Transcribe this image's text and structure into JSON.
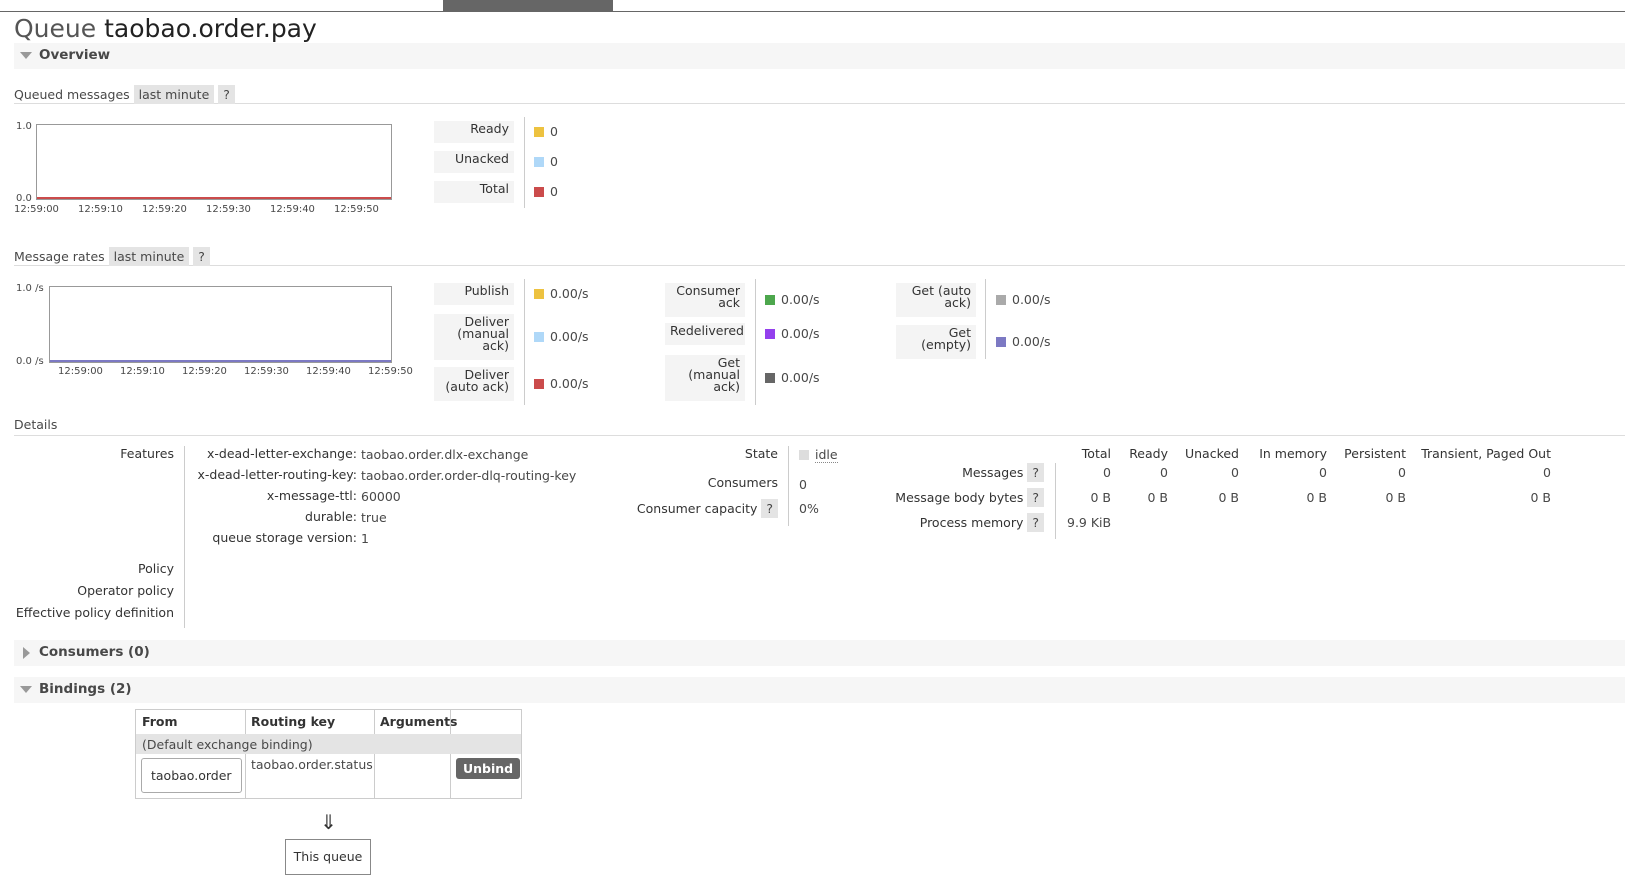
{
  "page": {
    "title_prefix": "Queue",
    "queue_name": "taobao.order.pay"
  },
  "sections": {
    "overview": "Overview",
    "consumers": "Consumers (0)",
    "bindings": "Bindings (2)"
  },
  "queued": {
    "heading": "Queued messages",
    "range": "last minute",
    "help": "?",
    "y_top": "1.0",
    "y_bottom": "0.0",
    "x_ticks": [
      "12:59:00",
      "12:59:10",
      "12:59:20",
      "12:59:30",
      "12:59:40",
      "12:59:50"
    ],
    "legend": [
      {
        "label": "Ready",
        "value": "0",
        "color": "#edc240"
      },
      {
        "label": "Unacked",
        "value": "0",
        "color": "#afd8f8"
      },
      {
        "label": "Total",
        "value": "0",
        "color": "#cb4b4b"
      }
    ]
  },
  "rates": {
    "heading": "Message rates",
    "range": "last minute",
    "help": "?",
    "y_top": "1.0 /s",
    "y_bottom": "0.0 /s",
    "x_ticks": [
      "12:59:00",
      "12:59:10",
      "12:59:20",
      "12:59:30",
      "12:59:40",
      "12:59:50"
    ],
    "col1": [
      {
        "label": "Publish",
        "value": "0.00/s",
        "color": "#edc240"
      },
      {
        "label": "Deliver (manual ack)",
        "value": "0.00/s",
        "color": "#afd8f8"
      },
      {
        "label": "Deliver (auto ack)",
        "value": "0.00/s",
        "color": "#cb4b4b"
      }
    ],
    "col2": [
      {
        "label": "Consumer ack",
        "value": "0.00/s",
        "color": "#4da74d"
      },
      {
        "label": "Redelivered",
        "value": "0.00/s",
        "color": "#9440ed"
      },
      {
        "label": "Get (manual ack)",
        "value": "0.00/s",
        "color": "#666666"
      }
    ],
    "col3": [
      {
        "label": "Get (auto ack)",
        "value": "0.00/s",
        "color": "#aaaaaa"
      },
      {
        "label": "Get (empty)",
        "value": "0.00/s",
        "color": "#7c79c3"
      }
    ]
  },
  "details": {
    "heading": "Details",
    "features_label": "Features",
    "features": [
      {
        "k": "x-dead-letter-exchange:",
        "v": "taobao.order.dlx-exchange"
      },
      {
        "k": "x-dead-letter-routing-key:",
        "v": "taobao.order.order-dlq-routing-key"
      },
      {
        "k": "x-message-ttl:",
        "v": "60000"
      },
      {
        "k": "durable:",
        "v": "true"
      },
      {
        "k": "queue storage version:",
        "v": "1"
      }
    ],
    "policy": "Policy",
    "operator_policy": "Operator policy",
    "effective_policy": "Effective policy definition",
    "state_label": "State",
    "state_value": "idle",
    "consumers_label": "Consumers",
    "consumers_value": "0",
    "capacity_label": "Consumer capacity",
    "capacity_help": "?",
    "capacity_value": "0%",
    "stats_headers": [
      "Total",
      "Ready",
      "Unacked",
      "In memory",
      "Persistent",
      "Transient, Paged Out"
    ],
    "messages_label": "Messages",
    "messages_help": "?",
    "messages_values": [
      "0",
      "0",
      "0",
      "0",
      "0",
      "0"
    ],
    "body_label": "Message body bytes",
    "body_help": "?",
    "body_values": [
      "0 B",
      "0 B",
      "0 B",
      "0 B",
      "0 B",
      "0 B"
    ],
    "memory_label": "Process memory",
    "memory_help": "?",
    "memory_value": "9.9 KiB"
  },
  "bindings": {
    "headers": [
      "From",
      "Routing key",
      "Arguments"
    ],
    "default_row": "(Default exchange binding)",
    "row": {
      "from": "taobao.order",
      "routing_key": "taobao.order.status",
      "arguments": "",
      "unbind": "Unbind"
    },
    "arrow": "⇓",
    "this_queue": "This queue"
  }
}
